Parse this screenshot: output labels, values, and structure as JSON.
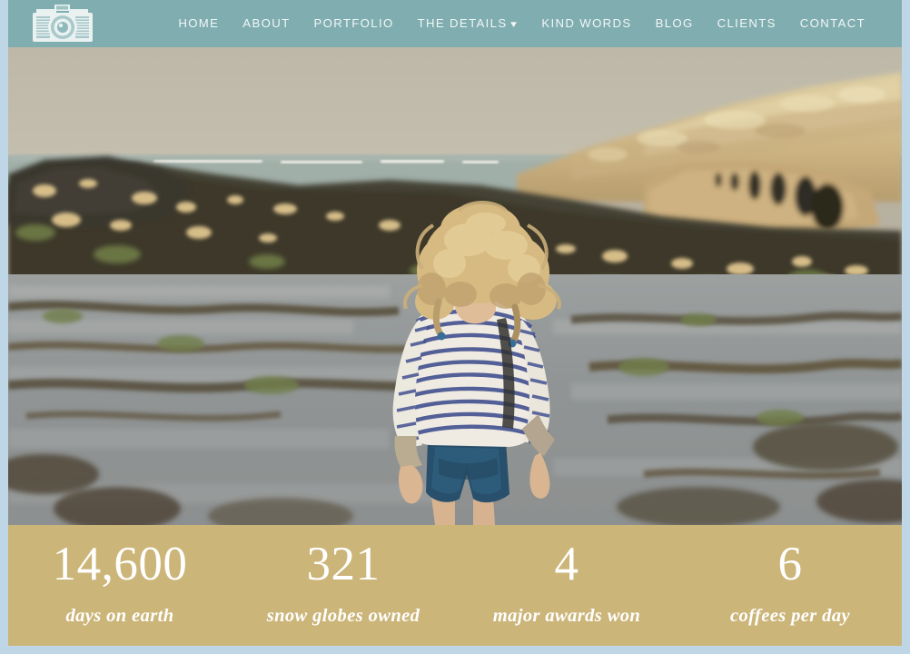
{
  "header": {
    "logo_icon": "vintage-camera-icon",
    "logo_alt": "camera logo",
    "background_color": "#7FADB0",
    "nav": [
      {
        "label": "HOME",
        "has_dropdown": false
      },
      {
        "label": "ABOUT",
        "has_dropdown": false
      },
      {
        "label": "PORTFOLIO",
        "has_dropdown": false
      },
      {
        "label": "THE DETAILS",
        "has_dropdown": true,
        "caret": "⌄"
      },
      {
        "label": "KIND WORDS",
        "has_dropdown": false
      },
      {
        "label": "BLOG",
        "has_dropdown": false
      },
      {
        "label": "CLIENTS",
        "has_dropdown": false
      },
      {
        "label": "CONTACT",
        "has_dropdown": false
      }
    ]
  },
  "hero": {
    "alt": "Young child with curly blonde hair wearing a blue and white striped long-sleeve shirt and navy shorts, walking on a rocky tidal beach with seaweed-covered rocks, sandy cliffs and the sea behind",
    "sky_color": "#B9B6A8",
    "sea_color": "#93A9A6",
    "cliff_color": "#D3BE8C",
    "rock_color": "#3B3A30",
    "sand_color": "#8E9397"
  },
  "stats": {
    "background_color": "#CCB579",
    "text_color": "#FFFFFF",
    "items": [
      {
        "number": "14,600",
        "label": "days on earth"
      },
      {
        "number": "321",
        "label": "snow globes owned"
      },
      {
        "number": "4",
        "label": "major awards won"
      },
      {
        "number": "6",
        "label": "coffees per day"
      }
    ]
  },
  "page": {
    "border_color": "#BFD6E6",
    "background_color": "#FFFFFF"
  }
}
